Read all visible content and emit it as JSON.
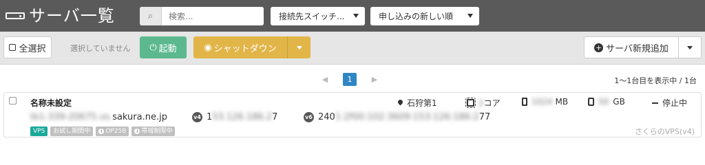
{
  "header": {
    "title": "サーバ一覧",
    "search_placeholder": "検索...",
    "connect_select": "接続先スイッチ...",
    "sort_select": "申し込みの新しい順"
  },
  "toolbar": {
    "select_all": "全選択",
    "no_selection": "選択していません",
    "start": "起動",
    "shutdown": "シャットダウン",
    "add_server": "サーバ新規追加"
  },
  "pagination": {
    "current_page": "1",
    "range_text": "1〜1台目を表示中 / 1台"
  },
  "server": {
    "name": "名称未設定",
    "hostname_blurred": "tk1-339-20675.vs.",
    "hostname_visible": "sakura.ne.jp",
    "ipv4_badge": "v4",
    "ipv4_prefix": "1",
    "ipv4_blurred": "53.126.186.2",
    "ipv4_suffix": "7",
    "ipv6_badge": "v6",
    "ipv6_prefix": "240",
    "ipv6_blurred": "1:2f00:102:3609:153:126:186:2",
    "ipv6_suffix": "77",
    "location": "石狩第1",
    "cpu_blurred": "2",
    "cpu_unit": "コア",
    "memory_blurred": "1024",
    "memory_unit": "MB",
    "disk_blurred": "50",
    "disk_unit": "GB",
    "status": "停止中",
    "tags": [
      "VPS",
      "お試し期間中",
      "OP25B",
      "帯域制限中"
    ],
    "plan": "さくらのVPS(v4)"
  }
}
